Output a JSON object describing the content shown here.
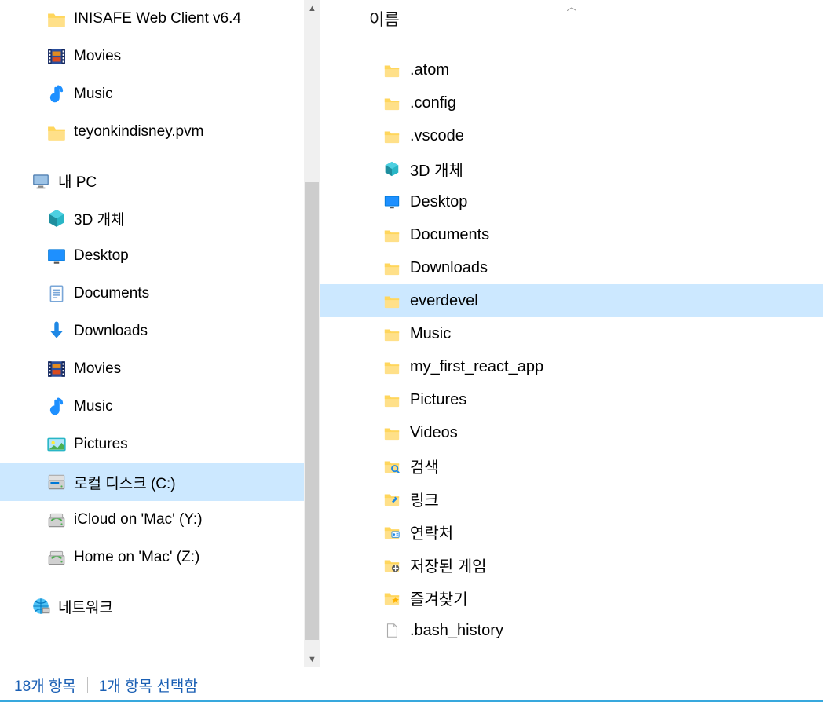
{
  "column_header": "이름",
  "tree": [
    {
      "label": "INISAFE Web Client v6.4",
      "icon": "folder",
      "indent": "indent1",
      "selected": false
    },
    {
      "label": "Movies",
      "icon": "movies",
      "indent": "indent1",
      "selected": false
    },
    {
      "label": "Music",
      "icon": "music",
      "indent": "indent1",
      "selected": false
    },
    {
      "label": "teyonkindisney.pvm",
      "icon": "folder",
      "indent": "indent1",
      "selected": false
    },
    {
      "label": "내 PC",
      "icon": "pc",
      "indent": "indentRoot",
      "selected": false
    },
    {
      "label": "3D 개체",
      "icon": "cube",
      "indent": "indent1",
      "selected": false
    },
    {
      "label": "Desktop",
      "icon": "desktop",
      "indent": "indent1",
      "selected": false
    },
    {
      "label": "Documents",
      "icon": "documents",
      "indent": "indent1",
      "selected": false
    },
    {
      "label": "Downloads",
      "icon": "downloads",
      "indent": "indent1",
      "selected": false
    },
    {
      "label": "Movies",
      "icon": "movies",
      "indent": "indent1",
      "selected": false
    },
    {
      "label": "Music",
      "icon": "music",
      "indent": "indent1",
      "selected": false
    },
    {
      "label": "Pictures",
      "icon": "pictures",
      "indent": "indent1",
      "selected": false
    },
    {
      "label": "로컬 디스크 (C:)",
      "icon": "disk",
      "indent": "indent1",
      "selected": true
    },
    {
      "label": "iCloud on 'Mac' (Y:)",
      "icon": "netdisk",
      "indent": "indent1",
      "selected": false
    },
    {
      "label": "Home on 'Mac' (Z:)",
      "icon": "netdisk",
      "indent": "indent1",
      "selected": false
    },
    {
      "label": "네트워크",
      "icon": "network",
      "indent": "indentRoot",
      "selected": false
    }
  ],
  "files": [
    {
      "label": ".atom",
      "icon": "folder",
      "selected": false
    },
    {
      "label": ".config",
      "icon": "folder",
      "selected": false
    },
    {
      "label": ".vscode",
      "icon": "folder",
      "selected": false
    },
    {
      "label": "3D 개체",
      "icon": "cube",
      "selected": false
    },
    {
      "label": "Desktop",
      "icon": "desktop",
      "selected": false
    },
    {
      "label": "Documents",
      "icon": "folder",
      "selected": false
    },
    {
      "label": "Downloads",
      "icon": "folder",
      "selected": false
    },
    {
      "label": "everdevel",
      "icon": "folder",
      "selected": true
    },
    {
      "label": "Music",
      "icon": "folder",
      "selected": false
    },
    {
      "label": "my_first_react_app",
      "icon": "folder",
      "selected": false
    },
    {
      "label": "Pictures",
      "icon": "folder",
      "selected": false
    },
    {
      "label": "Videos",
      "icon": "folder",
      "selected": false
    },
    {
      "label": "검색",
      "icon": "search",
      "selected": false
    },
    {
      "label": "링크",
      "icon": "links",
      "selected": false
    },
    {
      "label": "연락처",
      "icon": "contacts",
      "selected": false
    },
    {
      "label": "저장된 게임",
      "icon": "games",
      "selected": false
    },
    {
      "label": "즐겨찾기",
      "icon": "favorites",
      "selected": false
    },
    {
      "label": ".bash_history",
      "icon": "file",
      "selected": false
    }
  ],
  "status": {
    "count": "18개 항목",
    "selection": "1개 항목 선택함"
  }
}
